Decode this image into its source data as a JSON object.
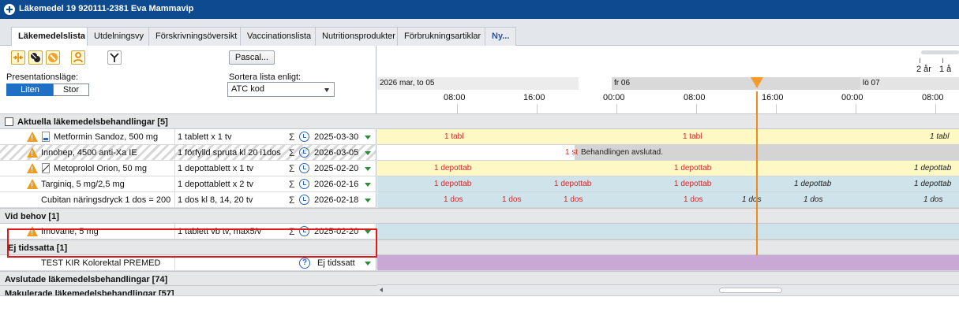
{
  "window": {
    "title": "Läkemedel 19 920111-2381 Eva Mammavip"
  },
  "tabs": [
    {
      "label": "Läkemedelslista",
      "active": true
    },
    {
      "label": "Utdelningsvy"
    },
    {
      "label": "Förskrivningsöversikt"
    },
    {
      "label": "Vaccinationslista"
    },
    {
      "label": "Nutritionsprodukter"
    },
    {
      "label": "Förbrukningsartiklar"
    },
    {
      "label": "Ny..."
    }
  ],
  "toolbar": {
    "pascal_label": "Pascal...",
    "presentation_label": "Presentationsläge:",
    "mode_small": "Liten",
    "mode_large": "Stor",
    "sort_label": "Sortera lista enligt:",
    "sort_value": "ATC kod"
  },
  "timeline": {
    "zoom": [
      "2 år",
      "1 å"
    ],
    "days": [
      "2026 mar, to 05",
      "fr 06",
      "lö 07"
    ],
    "hours": [
      "08:00",
      "16:00",
      "00:00",
      "08:00",
      "16:00",
      "00:00",
      "08:00"
    ],
    "current_time_color": "#f08a1c"
  },
  "sections": {
    "current": "Aktuella läkemedelsbehandlingar [5]",
    "as_needed": "Vid behov [1]",
    "untimed": "Ej tidssatta [1]",
    "completed": "Avslutade läkemedelsbehandlingar [74]",
    "cancelled": "Makulerade läkemedelsbehandlingar [57]"
  },
  "rows": [
    {
      "name": "Metformin Sandoz, 500 mg",
      "dose": "1 tablett x 1 tv",
      "date": "2025-03-30",
      "doses": [
        "1 tabl",
        "1 tabl",
        "1 tabl"
      ]
    },
    {
      "name": "Innohep, 4500 anti-Xa IE",
      "dose": "1 förfylld spruta kl 20 i1dos",
      "date": "2026-03-05",
      "doses": [
        "1 st"
      ],
      "note": "Behandlingen avslutad."
    },
    {
      "name": "Metoprolol Orion, 50 mg",
      "dose": "1 depottablett x 1 tv",
      "date": "2025-02-20",
      "doses": [
        "1 depottab",
        "1 depottab",
        "1 depottab"
      ]
    },
    {
      "name": "Targiniq, 5 mg/2,5 mg",
      "dose": "1 depottablett x 2 tv",
      "date": "2026-02-16",
      "doses": [
        "1 depottab",
        "1 depottab",
        "1 depottab",
        "1 depottab",
        "1 depottab"
      ]
    },
    {
      "name": "Cubitan näringsdryck 1 dos = 200 ...",
      "dose": "1 dos kl 8, 14, 20 tv",
      "date": "2026-02-18",
      "doses": [
        "1 dos",
        "1 dos",
        "1 dos",
        "1 dos",
        "1 dos",
        "1 dos",
        "1 dos"
      ]
    }
  ],
  "as_needed_rows": [
    {
      "name": "Imovane, 5 mg",
      "dose": "1 tablett vb tv, max5/v",
      "date": "2025-02-20"
    }
  ],
  "untimed_rows": [
    {
      "name": "TEST KIR Kolorektal PREMED",
      "status": "Ej tidssatt"
    }
  ],
  "colors": {
    "titlebar": "#0d4a8f",
    "yellow_row": "#fdf8c4",
    "blue_row": "#cfe3ea",
    "purple_row": "#c9a8d6",
    "grey_row": "#d9d9d9",
    "highlight": "#e01919"
  }
}
